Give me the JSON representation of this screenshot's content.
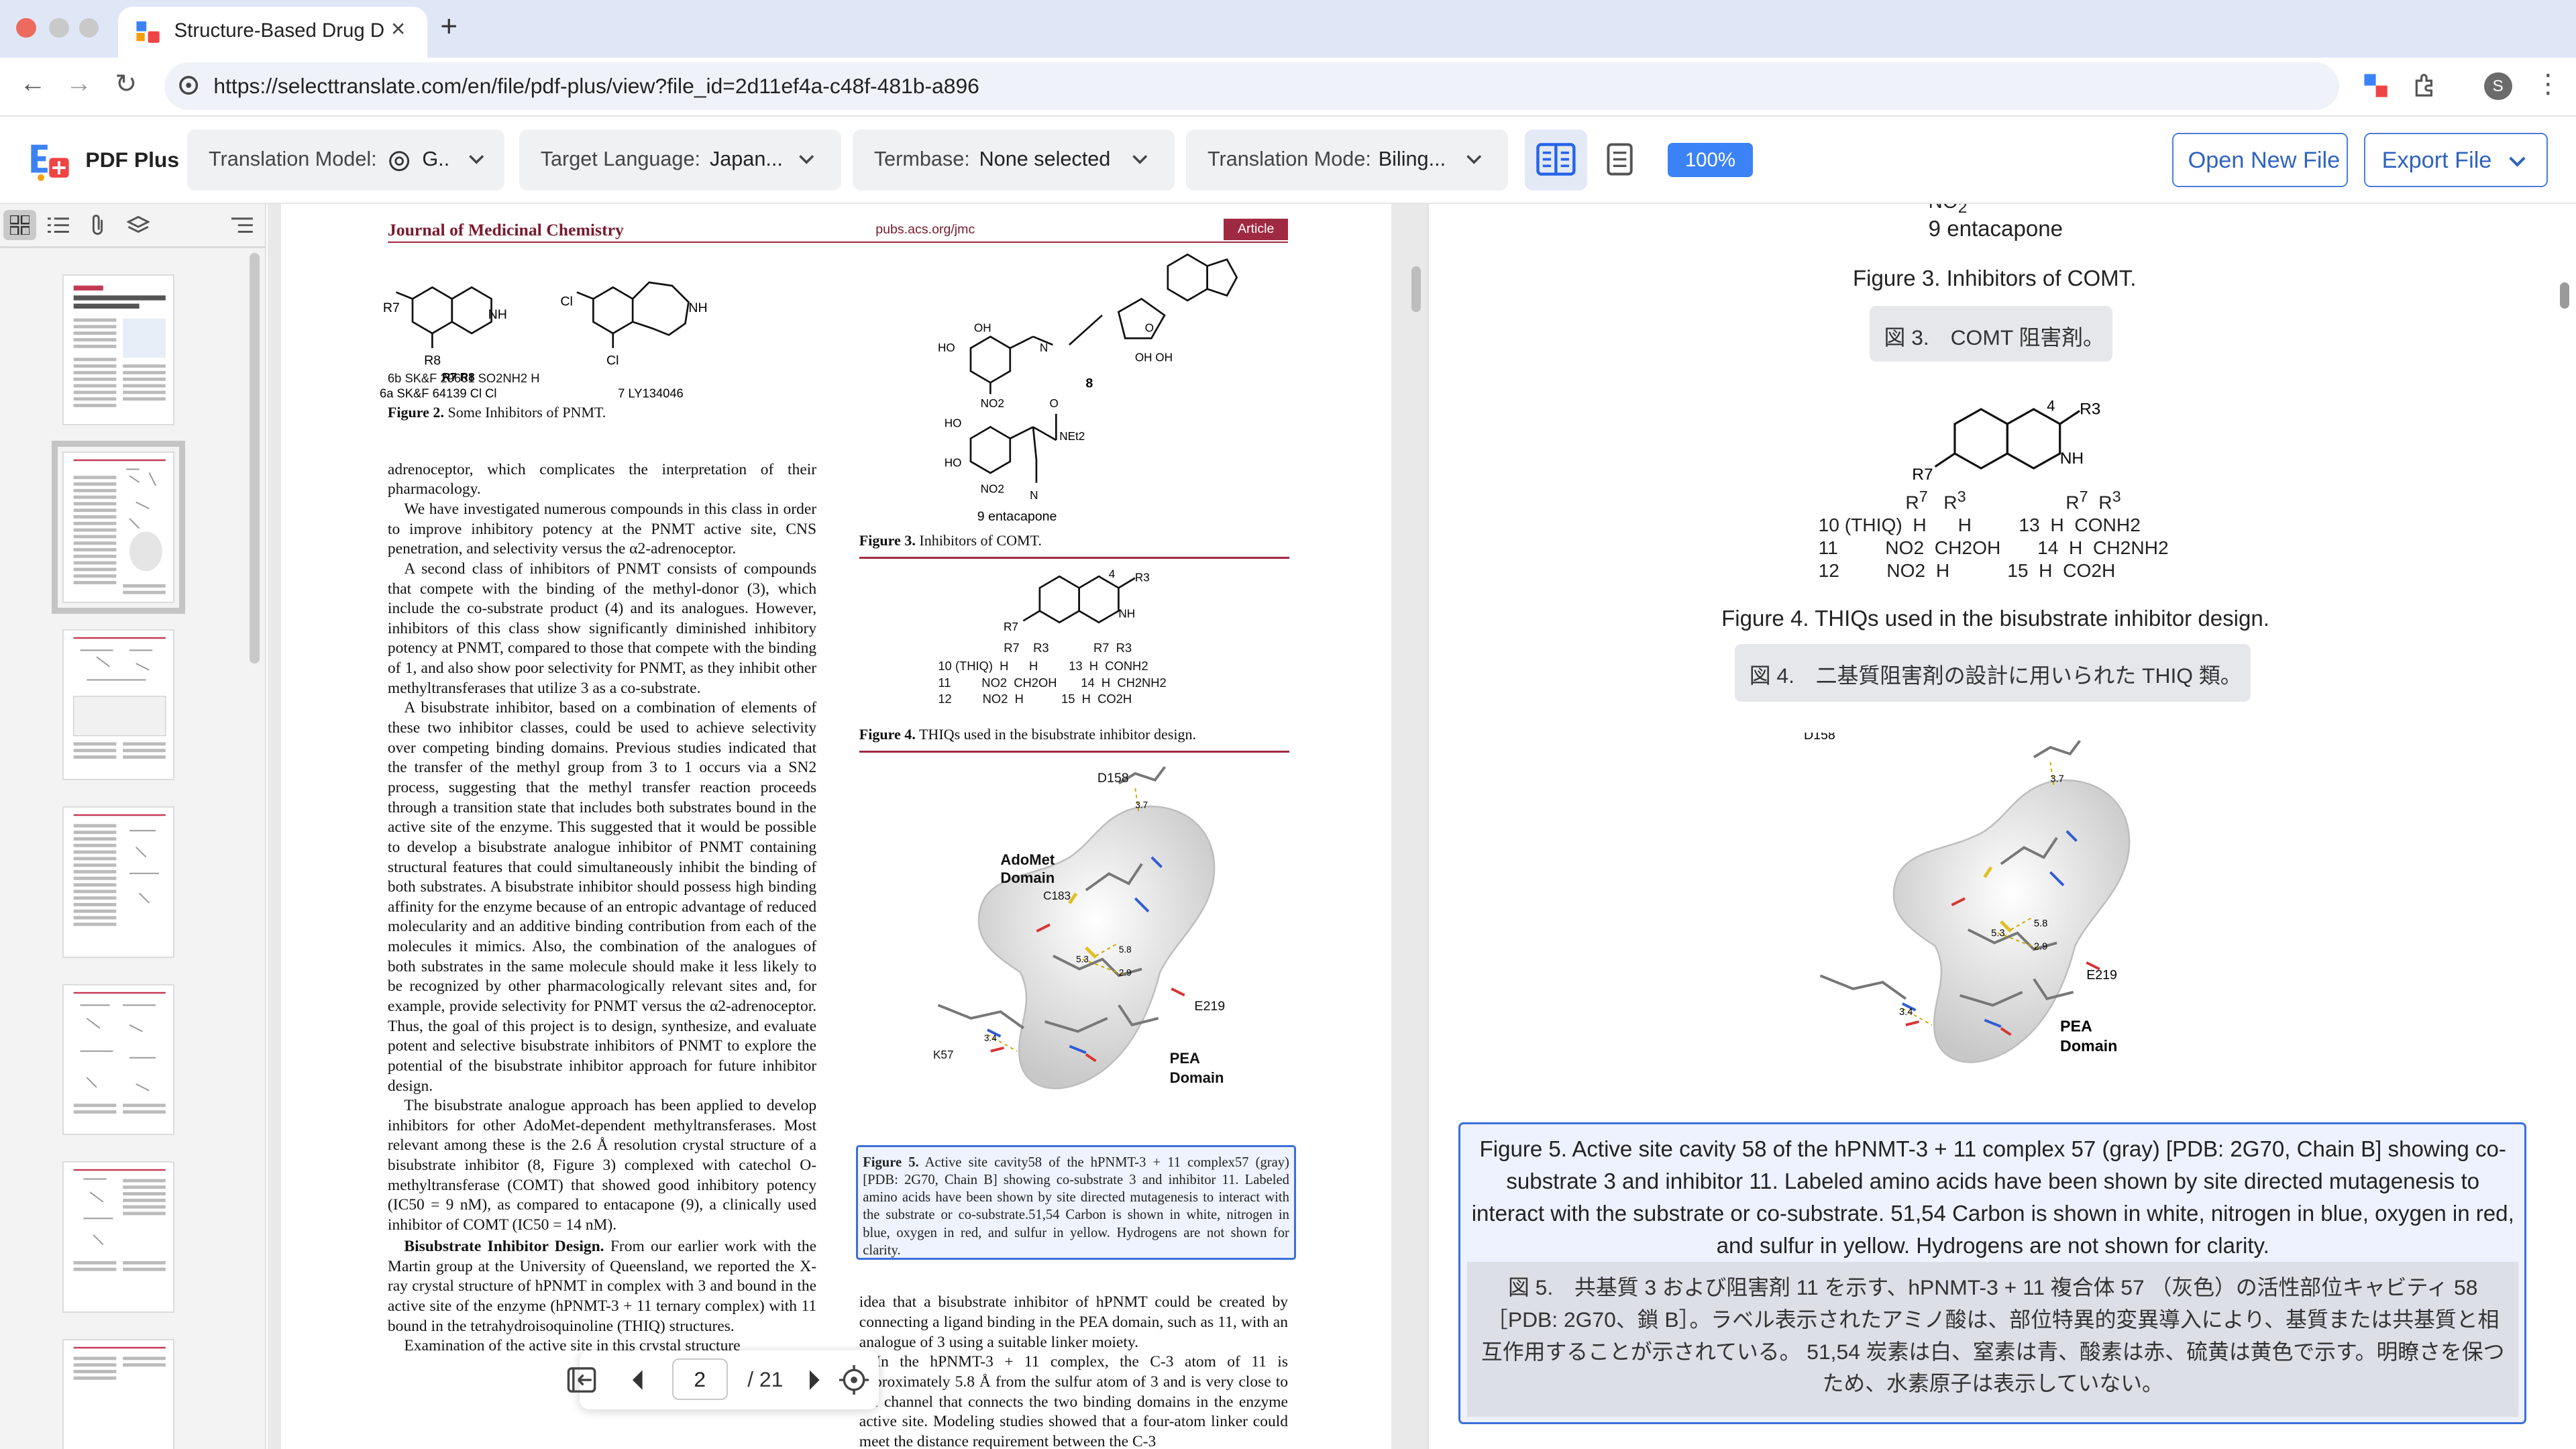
{
  "browser": {
    "tab_title": "Structure-Based Drug Design",
    "url": "https://selecttranslate.com/en/file/pdf-plus/view?file_id=2d11ef4a-c48f-481b-a896",
    "profile_initial": "S"
  },
  "app": {
    "brand": "PDF Plus",
    "translation_model_label": "Translation Model:",
    "translation_model_value": "G..",
    "target_language_label": "Target Language:",
    "target_language_value": "Japan...",
    "termbase_label": "Termbase:",
    "termbase_value": "None selected",
    "translation_mode_label": "Translation Mode:",
    "translation_mode_value": "Biling...",
    "zoom": "100%",
    "open_new_file": "Open New File",
    "export_file": "Export File"
  },
  "viewer": {
    "current_page": "2",
    "total_pages": "/ 21"
  },
  "pdf": {
    "journal": "Journal of Medicinal Chemistry",
    "journal_url": "pubs.acs.org/jmc",
    "article_tag": "Article",
    "fig2_caption_label": "Figure 2.",
    "fig2_caption_text": "Some Inhibitors of PNMT.",
    "fig3_caption_label": "Figure 3.",
    "fig3_caption_text": "Inhibitors of COMT.",
    "fig4_caption_label": "Figure 4.",
    "fig4_caption_text": "THIQs used in the bisubstrate inhibitor design.",
    "fig5_caption_label": "Figure 5.",
    "fig5_caption_text": "Active site cavity58 of the hPNMT-3 + 11 complex57 (gray) [PDB: 2G70, Chain B] showing co-substrate 3 and inhibitor 11. Labeled amino acids have been shown by site directed mutagenesis to interact with the substrate or co-substrate.51,54 Carbon is shown in white, nitrogen in blue, oxygen in red, and sulfur in yellow. Hydrogens are not shown for clarity.",
    "compounds": {
      "c6a": "6a SK&F 64139  Cl     Cl",
      "c6b": "6b SK&F 29661  SO2NH2  H",
      "c7": "7 LY134046",
      "c8": "8",
      "c9": "9 entacapone"
    },
    "thiq_table": {
      "r10": "10 (THIQ)  H      H         13  H  CONH2",
      "r11": "11         NO2  CH2OH       14  H  CH2NH2",
      "r12": "12         NO2  H           15  H  CO2H"
    },
    "residues": {
      "d158": "D158",
      "adomet": "AdoMet",
      "domain": "Domain",
      "c183": "C183",
      "e219": "E219",
      "k57": "K57",
      "pea": "PEA",
      "d37": "3.7",
      "d53": "5.3",
      "d58": "5.8",
      "d29": "2.9",
      "d34": "3.4"
    },
    "col1_p1": "adrenoceptor, which complicates the interpretation of their pharmacology.",
    "col1_p2": "We have investigated numerous compounds in this class in order to improve inhibitory potency at the PNMT active site, CNS penetration, and selectivity versus the α2-adrenoceptor.",
    "col1_p3": "A second class of inhibitors of PNMT consists of compounds that compete with the binding of the methyl-donor (3), which include the co-substrate product (4) and its analogues. However, inhibitors of this class show significantly diminished inhibitory potency at PNMT, compared to those that compete with the binding of 1, and also show poor selectivity for PNMT, as they inhibit other methyltransferases that utilize 3 as a co-substrate.",
    "col1_p4": "A bisubstrate inhibitor, based on a combination of elements of these two inhibitor classes, could be used to achieve selectivity over competing binding domains. Previous studies indicated that the transfer of the methyl group from 3 to 1 occurs via a SN2 process, suggesting that the methyl transfer reaction proceeds through a transition state that includes both substrates bound in the active site of the enzyme. This suggested that it would be possible to develop a bisubstrate analogue inhibitor of PNMT containing structural features that could simultaneously inhibit the binding of both substrates. A bisubstrate inhibitor should possess high binding affinity for the enzyme because of an entropic advantage of reduced molecularity and an additive binding contribution from each of the molecules it mimics. Also, the combination of the analogues of both substrates in the same molecule should make it less likely to be recognized by other pharmacologically relevant sites and, for example, provide selectivity for PNMT versus the α2-adrenoceptor. Thus, the goal of this project is to design, synthesize, and evaluate potent and selective bisubstrate inhibitors of PNMT to explore the potential of the bisubstrate inhibitor approach for future inhibitor design.",
    "col1_p5": "The bisubstrate analogue approach has been applied to develop inhibitors for other AdoMet-dependent methyltransferases. Most relevant among these is the 2.6 Å resolution crystal structure of a bisubstrate inhibitor (8, Figure 3) complexed with catechol O-methyltransferase (COMT) that showed good inhibitory potency (IC50 = 9 nM), as compared to entacapone (9), a clinically used inhibitor of COMT (IC50 = 14 nM).",
    "col1_head": "Bisubstrate Inhibitor Design.",
    "col1_p6": "From our earlier work with the Martin group at the University of Queensland, we reported the X-ray crystal structure of hPNMT in complex with 3 and bound in the active site of the enzyme (hPNMT-3 + 11 ternary complex) with 11 bound in the tetrahydroisoquinoline (THIQ) structures.",
    "col1_p7": "Examination of the active site in this crystal structure",
    "col2_p1": "idea that a bisubstrate inhibitor of hPNMT could be created by connecting a ligand binding in the PEA domain, such as 11, with an analogue of 3 using a suitable linker moiety.",
    "col2_p2": "In the hPNMT-3 + 11 complex, the C-3 atom of 11 is approximately 5.8 Å from the sulfur atom of 3 and is very close to the channel that connects the two binding domains in the enzyme active site. Modeling studies showed that a four-atom linker could meet the distance requirement between the C-3"
  },
  "translation": {
    "entacapone": "9 entacapone",
    "fig3_en": "Figure 3. Inhibitors of COMT.",
    "fig3_jp": "図 3.　COMT 阻害剤。",
    "fig4_en": "Figure 4. THIQs used in the bisubstrate inhibitor design.",
    "fig4_jp": "図 4.　二基質阻害剤の設計に用いられた THIQ 類。",
    "fig5_en": "Figure 5. Active site cavity 58 of the hPNMT-3 + 11 complex 57 (gray) [PDB: 2G70, Chain B] showing co-substrate 3 and inhibitor 11. Labeled amino acids have been shown by site directed mutagenesis to interact with the substrate or co-substrate. 51,54 Carbon is shown in white, nitrogen in blue, oxygen in red, and sulfur in yellow. Hydrogens are not shown for clarity.",
    "fig5_jp": "図 5.　共基質 3 および阻害剤 11 を示す、hPNMT-3 + 11 複合体 57 （灰色）の活性部位キャビティ 58 ［PDB: 2G70、鎖 B］。ラベル表示されたアミノ酸は、部位特異的変異導入により、基質または共基質と相互作用することが示されている。 51,54 炭素は白、窒素は青、酸素は赤、硫黄は黄色で示す。明瞭さを保つため、水素原子は表示していない。"
  },
  "colors": {
    "accent": "#3b82f6",
    "journal_red": "#a02942",
    "selection_border": "#3b6fd8"
  }
}
